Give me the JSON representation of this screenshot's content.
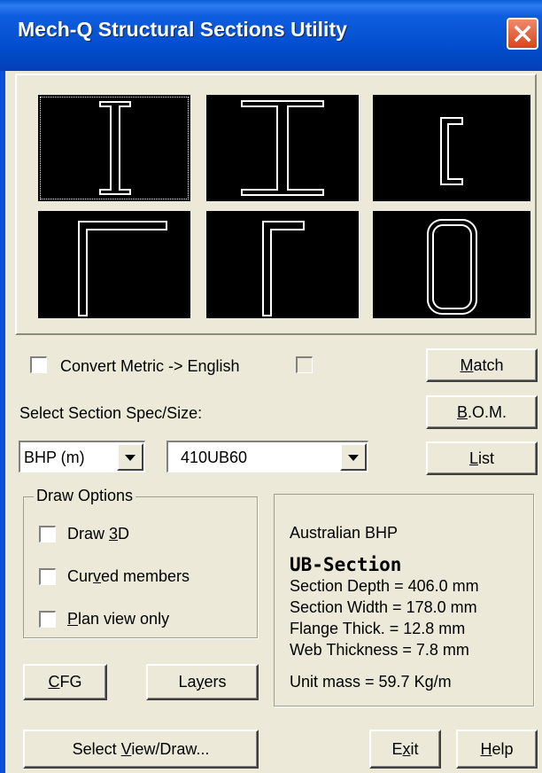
{
  "window": {
    "title": "Mech-Q Structural Sections Utility"
  },
  "section_shapes": [
    {
      "icon": "i-beam-tall-icon",
      "selected": true
    },
    {
      "icon": "i-beam-wide-icon",
      "selected": false
    },
    {
      "icon": "channel-icon",
      "selected": false
    },
    {
      "icon": "equal-angle-icon",
      "selected": false
    },
    {
      "icon": "unequal-angle-icon",
      "selected": false
    },
    {
      "icon": "rectangular-hollow-section-icon",
      "selected": false
    }
  ],
  "options": {
    "convert_label": "Convert Metric -> English",
    "convert_checked": false,
    "extra_checked": false
  },
  "spec": {
    "label": "Select Section Spec/Size:",
    "spec_value": "BHP (m)",
    "size_value": "410UB60"
  },
  "buttons": {
    "match": {
      "pre": "",
      "key": "M",
      "post": "atch"
    },
    "bom": {
      "pre": "",
      "key": "B",
      "post": ".O.M."
    },
    "list": {
      "pre": "",
      "key": "L",
      "post": "ist"
    },
    "cfg": {
      "pre": "",
      "key": "C",
      "post": "FG"
    },
    "layers": {
      "pre": "La",
      "key": "y",
      "post": "ers"
    },
    "select_view": {
      "pre": "Select ",
      "key": "V",
      "post": "iew/Draw..."
    },
    "exit": {
      "pre": "E",
      "key": "x",
      "post": "it"
    },
    "help": {
      "pre": "",
      "key": "H",
      "post": "elp"
    }
  },
  "draw_options": {
    "title": "Draw Options",
    "draw3d": {
      "pre": "Draw ",
      "key": "3",
      "post": "D",
      "checked": false
    },
    "curved": {
      "pre": "Cur",
      "key": "v",
      "post": "ed members",
      "checked": false
    },
    "plan": {
      "pre": "",
      "key": "P",
      "post": "lan view only",
      "checked": false
    }
  },
  "section_info": {
    "standard": "Australian BHP",
    "type": "UB-Section",
    "depth": "Section Depth = 406.0 mm",
    "width": "Section Width = 178.0 mm",
    "flange": "Flange Thick. = 12.8 mm",
    "web": "Web Thickness = 7.8 mm",
    "mass": "Unit mass = 59.7 Kg/m"
  },
  "colors": {
    "titlebar": "#0450d0",
    "close_button": "#d9441c",
    "dialog_bg": "#ece9d8",
    "tile_bg": "#000000",
    "profile_stroke": "#ffffff"
  }
}
